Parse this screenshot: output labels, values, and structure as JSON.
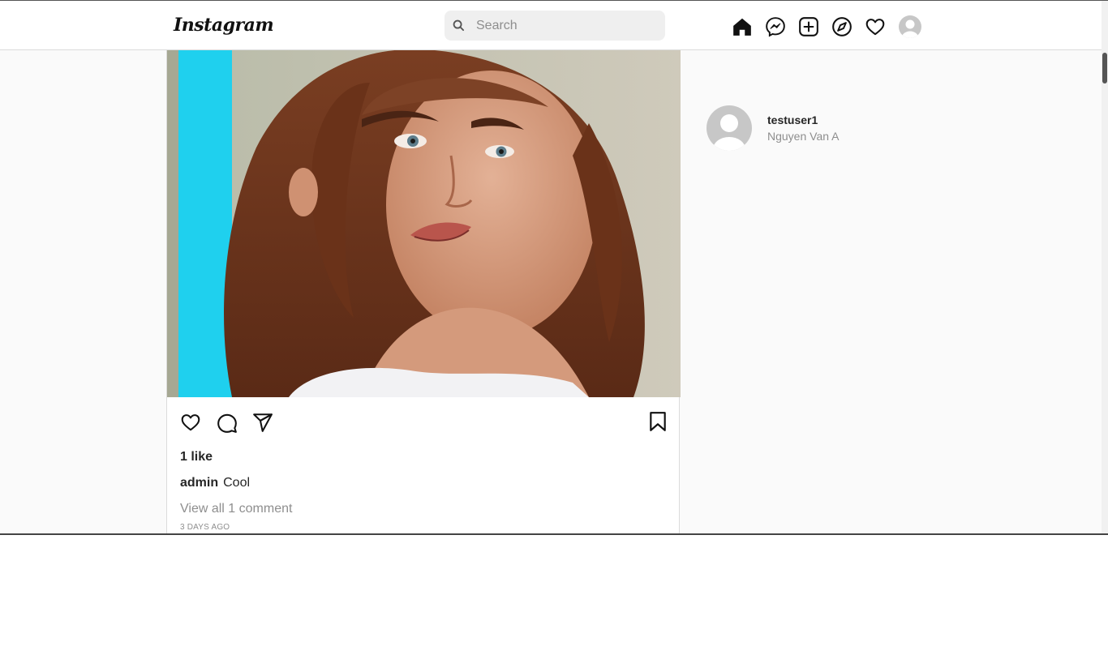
{
  "header": {
    "logo_text": "Instagram",
    "search": {
      "placeholder": "Search",
      "value": ""
    },
    "nav_icons": [
      "home-icon",
      "messenger-icon",
      "new-post-icon",
      "explore-icon",
      "activity-heart-icon",
      "profile-avatar"
    ]
  },
  "post": {
    "image_description": "",
    "likes": "1 like",
    "caption_user": "admin",
    "caption_text": "Cool",
    "view_comments": "View all 1 comment",
    "timestamp": "3 days ago"
  },
  "sidebar": {
    "username": "testuser1",
    "full_name": "Nguyen Van A"
  },
  "colors": {
    "page_bg": "#fafafa",
    "secondary_text": "#8e8e8e",
    "primary_text": "#262626",
    "search_bg": "#efefef"
  }
}
